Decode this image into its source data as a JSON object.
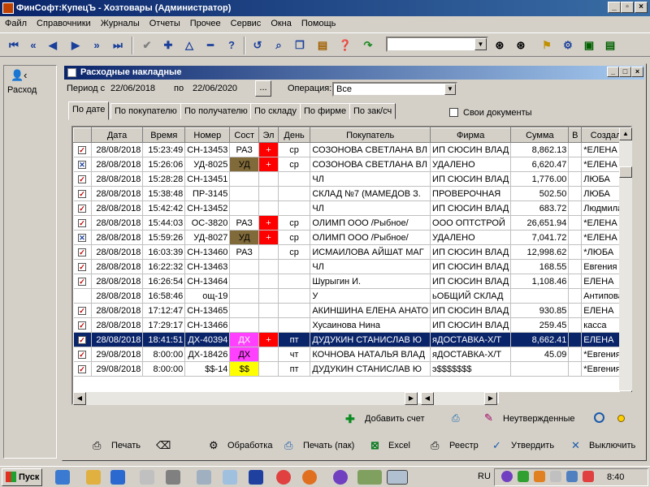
{
  "app": {
    "title": "ФинСофт:КупецЪ - Хозтовары  (Администратор)"
  },
  "menu": [
    "Файл",
    "Справочники",
    "Журналы",
    "Отчеты",
    "Прочее",
    "Сервис",
    "Окна",
    "Помощь"
  ],
  "left_panel": {
    "label": "Расход"
  },
  "window": {
    "title": "Расходные накладные",
    "period_from_label": "Период с",
    "period_from": "22/06/2018",
    "period_to_label": "по",
    "period_to": "22/06/2020",
    "period_button": "...",
    "operation_label": "Операция:",
    "operation_value": "Все",
    "own_docs_label": "Свои документы"
  },
  "tabs": [
    "По дате",
    "По покупателю",
    "По получателю",
    "По складу",
    "По фирме",
    "По зак/сч"
  ],
  "grid": {
    "columns": [
      "",
      "Дата",
      "Время",
      "Номер",
      "Сост",
      "Эл",
      "День",
      "Покупатель",
      "Фирма",
      "Сумма",
      "В",
      "Создал"
    ],
    "rows": [
      {
        "mark": "✓",
        "date": "28/08/2018",
        "time": "15:23:49",
        "num": "СН-13453",
        "state": "РАЗ",
        "el": "+",
        "day": "ср",
        "buyer": "СОЗОНОВА СВЕТЛАНА ВЛ",
        "firm": "ИП СЮСИН ВЛАД",
        "sum": "8,862.13",
        "v": "",
        "creator": "*ЕЛЕНА"
      },
      {
        "mark": "✕",
        "date": "28/08/2018",
        "time": "15:26:06",
        "num": "УД-8025",
        "state": "УД",
        "el": "+",
        "day": "ср",
        "buyer": "СОЗОНОВА СВЕТЛАНА ВЛ",
        "firm": "УДАЛЕНО",
        "sum": "6,620.47",
        "v": "",
        "creator": "*ЕЛЕНА"
      },
      {
        "mark": "✓",
        "date": "28/08/2018",
        "time": "15:28:28",
        "num": "СН-13451",
        "state": "",
        "el": "",
        "day": "",
        "buyer": "ЧЛ",
        "firm": "ИП СЮСИН ВЛАД",
        "sum": "1,776.00",
        "v": "",
        "creator": "ЛЮБА"
      },
      {
        "mark": "✓",
        "date": "28/08/2018",
        "time": "15:38:48",
        "num": "ПР-3145",
        "state": "",
        "el": "",
        "day": "",
        "buyer": "СКЛАД №7 (МАМЕДОВ З.",
        "firm": "ПРОВЕРОЧНАЯ",
        "sum": "502.50",
        "v": "",
        "creator": "ЛЮБА"
      },
      {
        "mark": "✓",
        "date": "28/08/2018",
        "time": "15:42:42",
        "num": "СН-13452",
        "state": "",
        "el": "",
        "day": "",
        "buyer": "ЧЛ",
        "firm": "ИП СЮСИН ВЛАД",
        "sum": "683.72",
        "v": "",
        "creator": "Людмила"
      },
      {
        "mark": "✓",
        "date": "28/08/2018",
        "time": "15:44:03",
        "num": "ОС-3820",
        "state": "РАЗ",
        "el": "+",
        "day": "ср",
        "buyer": "ОЛИМП ООО /Рыбное/",
        "firm": "ООО ОПТСТРОЙ",
        "sum": "26,651.94",
        "v": "",
        "creator": "*ЕЛЕНА"
      },
      {
        "mark": "✕",
        "date": "28/08/2018",
        "time": "15:59:26",
        "num": "УД-8027",
        "state": "УД",
        "el": "+",
        "day": "ср",
        "buyer": "ОЛИМП ООО /Рыбное/",
        "firm": "УДАЛЕНО",
        "sum": "7,041.72",
        "v": "",
        "creator": "*ЕЛЕНА"
      },
      {
        "mark": "✓",
        "date": "28/08/2018",
        "time": "16:03:39",
        "num": "СН-13460",
        "state": "РАЗ",
        "el": "",
        "day": "ср",
        "buyer": "ИСМАИЛОВА АЙШАТ МАГ",
        "firm": "ИП СЮСИН ВЛАД",
        "sum": "12,998.62",
        "v": "",
        "creator": "*ЛЮБА"
      },
      {
        "mark": "✓",
        "date": "28/08/2018",
        "time": "16:22:32",
        "num": "СН-13463",
        "state": "",
        "el": "",
        "day": "",
        "buyer": "ЧЛ",
        "firm": "ИП СЮСИН ВЛАД",
        "sum": "168.55",
        "v": "",
        "creator": "Евгения"
      },
      {
        "mark": "✓",
        "date": "28/08/2018",
        "time": "16:26:54",
        "num": "СН-13464",
        "state": "",
        "el": "",
        "day": "",
        "buyer": "Шурыгин И.",
        "firm": "ИП СЮСИН ВЛАД",
        "sum": "1,108.46",
        "v": "",
        "creator": "ЕЛЕНА"
      },
      {
        "mark": "",
        "date": "28/08/2018",
        "time": "16:58:46",
        "num": "ощ-19",
        "state": "",
        "el": "",
        "day": "",
        "buyer": "У",
        "firm": "ьОБЩИЙ СКЛАД",
        "sum": "",
        "v": "",
        "creator": "Антипова"
      },
      {
        "mark": "✓",
        "date": "28/08/2018",
        "time": "17:12:47",
        "num": "СН-13465",
        "state": "",
        "el": "",
        "day": "",
        "buyer": "АКИНШИНА ЕЛЕНА АНАТО",
        "firm": "ИП СЮСИН ВЛАД",
        "sum": "930.85",
        "v": "",
        "creator": "ЕЛЕНА"
      },
      {
        "mark": "✓",
        "date": "28/08/2018",
        "time": "17:29:17",
        "num": "СН-13466",
        "state": "",
        "el": "",
        "day": "",
        "buyer": "Хусаинова Нина",
        "firm": "ИП СЮСИН ВЛАД",
        "sum": "259.45",
        "v": "",
        "creator": "касса"
      },
      {
        "mark": "✓",
        "date": "28/08/2018",
        "time": "18:41:51",
        "num": "ДХ-40394",
        "state": "ДХ",
        "el": "+",
        "day": "пт",
        "buyer": "ДУДУКИН СТАНИСЛАВ Ю",
        "firm": "яДОСТАВКА-Х/Т",
        "sum": "8,662.41",
        "v": "",
        "creator": "ЕЛЕНА",
        "selected": true
      },
      {
        "mark": "✓",
        "date": "29/08/2018",
        "time": "8:00:00",
        "num": "ДХ-18426",
        "state": "ДХ",
        "el": "",
        "day": "чт",
        "buyer": "КОЧНОВА НАТАЛЬЯ ВЛАД",
        "firm": "яДОСТАВКА-Х/Т",
        "sum": "45.09",
        "v": "",
        "creator": "*Евгения"
      },
      {
        "mark": "✓",
        "date": "29/08/2018",
        "time": "8:00:00",
        "num": "$$-14",
        "state": "$$",
        "el": "",
        "day": "пт",
        "buyer": "ДУДУКИН СТАНИСЛАВ Ю",
        "firm": "э$$$$$$$",
        "sum": "",
        "v": "",
        "creator": "*Евгения"
      }
    ]
  },
  "state_colors": {
    "РАЗ": "",
    "УД": "#806a3a",
    "ДХ": "#ff40ff",
    "$$": "#ffff00"
  },
  "el_color": "#ff0000",
  "bottom_bar_1": {
    "add_invoice": "Добавить счет",
    "unconfirmed": "Неутвержденные"
  },
  "bottom_bar_2": {
    "print": "Печать",
    "process": "Обработка",
    "print_pack": "Печать (пак)",
    "excel": "Excel",
    "registry": "Реестр",
    "confirm": "Утвердить",
    "disable": "Выключить"
  },
  "taskbar": {
    "start": "Пуск",
    "lang": "RU",
    "clock": "8:40"
  },
  "icons": [
    "app-icon",
    "first-icon",
    "prev-page-icon",
    "prev-icon",
    "next-icon",
    "next-page-icon",
    "last-icon",
    "check-icon",
    "add-icon",
    "triangle-icon",
    "minus-icon",
    "help-icon",
    "refresh-icon",
    "search-icon",
    "copy-icon",
    "paste-icon",
    "question-icon",
    "redo-icon",
    "binoculars-icon"
  ]
}
